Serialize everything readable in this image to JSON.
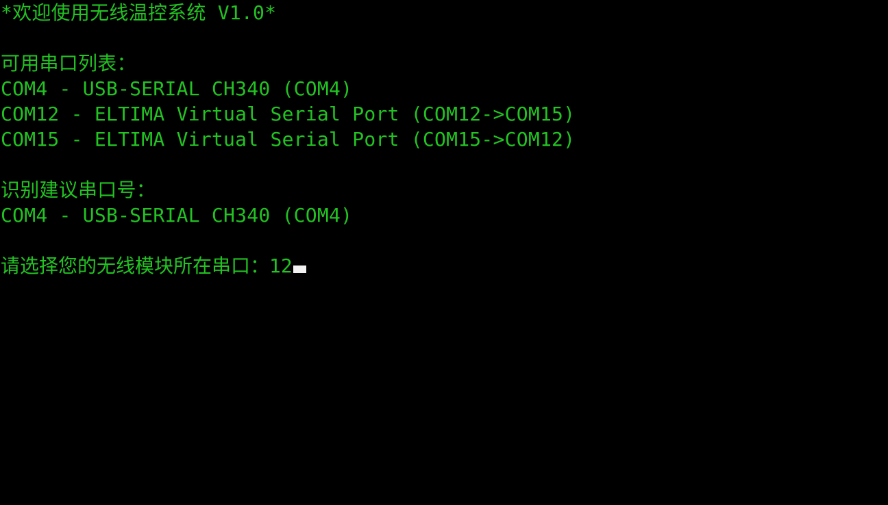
{
  "terminal": {
    "background_color": "#000000",
    "text_color": "#22c322",
    "cursor_color": "#f2f2f2",
    "banner": "*欢迎使用无线温控系统 V1.0*",
    "blank": "",
    "available_ports_heading": "可用串口列表：",
    "ports": [
      "COM4 - USB-SERIAL CH340 (COM4)",
      "COM12 - ELTIMA Virtual Serial Port (COM12->COM15)",
      "COM15 - ELTIMA Virtual Serial Port (COM15->COM12)"
    ],
    "suggested_heading": "识别建议串口号：",
    "suggested_port": "COM4 - USB-SERIAL CH340 (COM4)",
    "prompt_label": "请选择您的无线模块所在串口：",
    "prompt_value": "12"
  }
}
